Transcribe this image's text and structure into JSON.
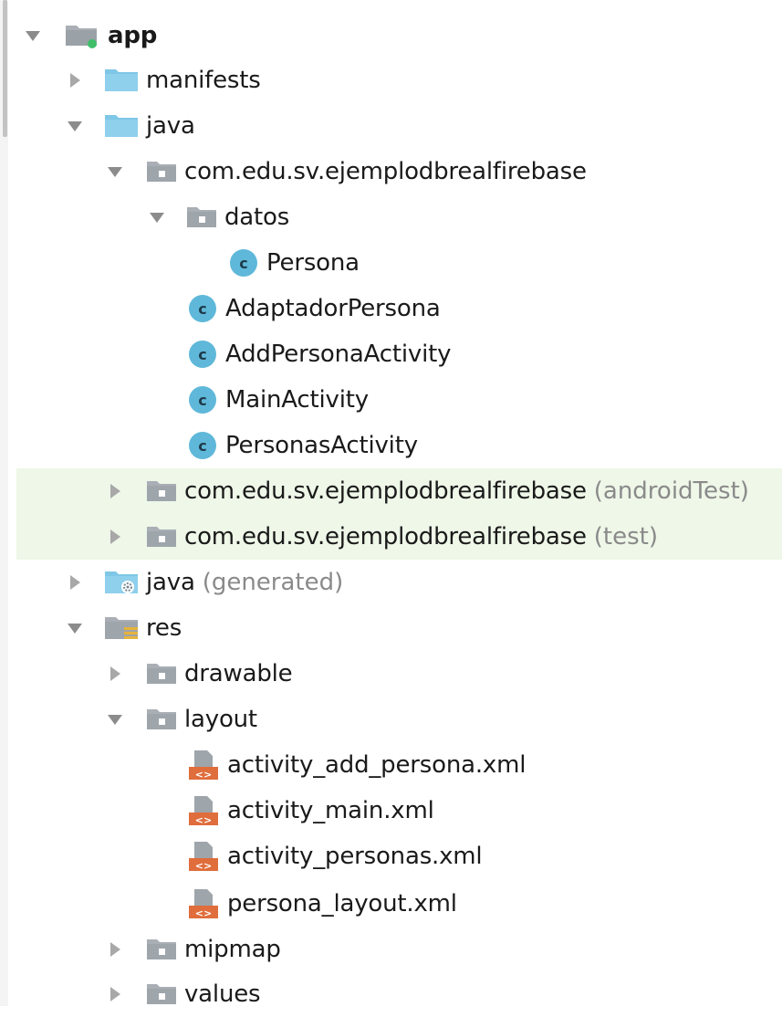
{
  "tree": {
    "app": "app",
    "manifests": "manifests",
    "java": "java",
    "package_main": "com.edu.sv.ejemplodbrealfirebase",
    "datos": "datos",
    "persona": "Persona",
    "adaptador": "AdaptadorPersona",
    "add_activity": "AddPersonaActivity",
    "main_activity": "MainActivity",
    "personas_activity": "PersonasActivity",
    "package_android_test": "com.edu.sv.ejemplodbrealfirebase",
    "android_test_suffix": "(androidTest)",
    "package_test": "com.edu.sv.ejemplodbrealfirebase",
    "test_suffix": "(test)",
    "java_generated": "java",
    "generated_suffix": "(generated)",
    "res": "res",
    "drawable": "drawable",
    "layout": "layout",
    "activity_add_persona": "activity_add_persona.xml",
    "activity_main": "activity_main.xml",
    "activity_personas": "activity_personas.xml",
    "persona_layout": "persona_layout.xml",
    "mipmap": "mipmap",
    "values": "values"
  },
  "colors": {
    "highlight": "#eef7e8",
    "class_icon": "#5fb8d9",
    "source_folder": "#7fc7e6",
    "package_folder": "#a9afb5",
    "xml_orange": "#e06d3c",
    "muted_text": "#8a8a8a"
  }
}
